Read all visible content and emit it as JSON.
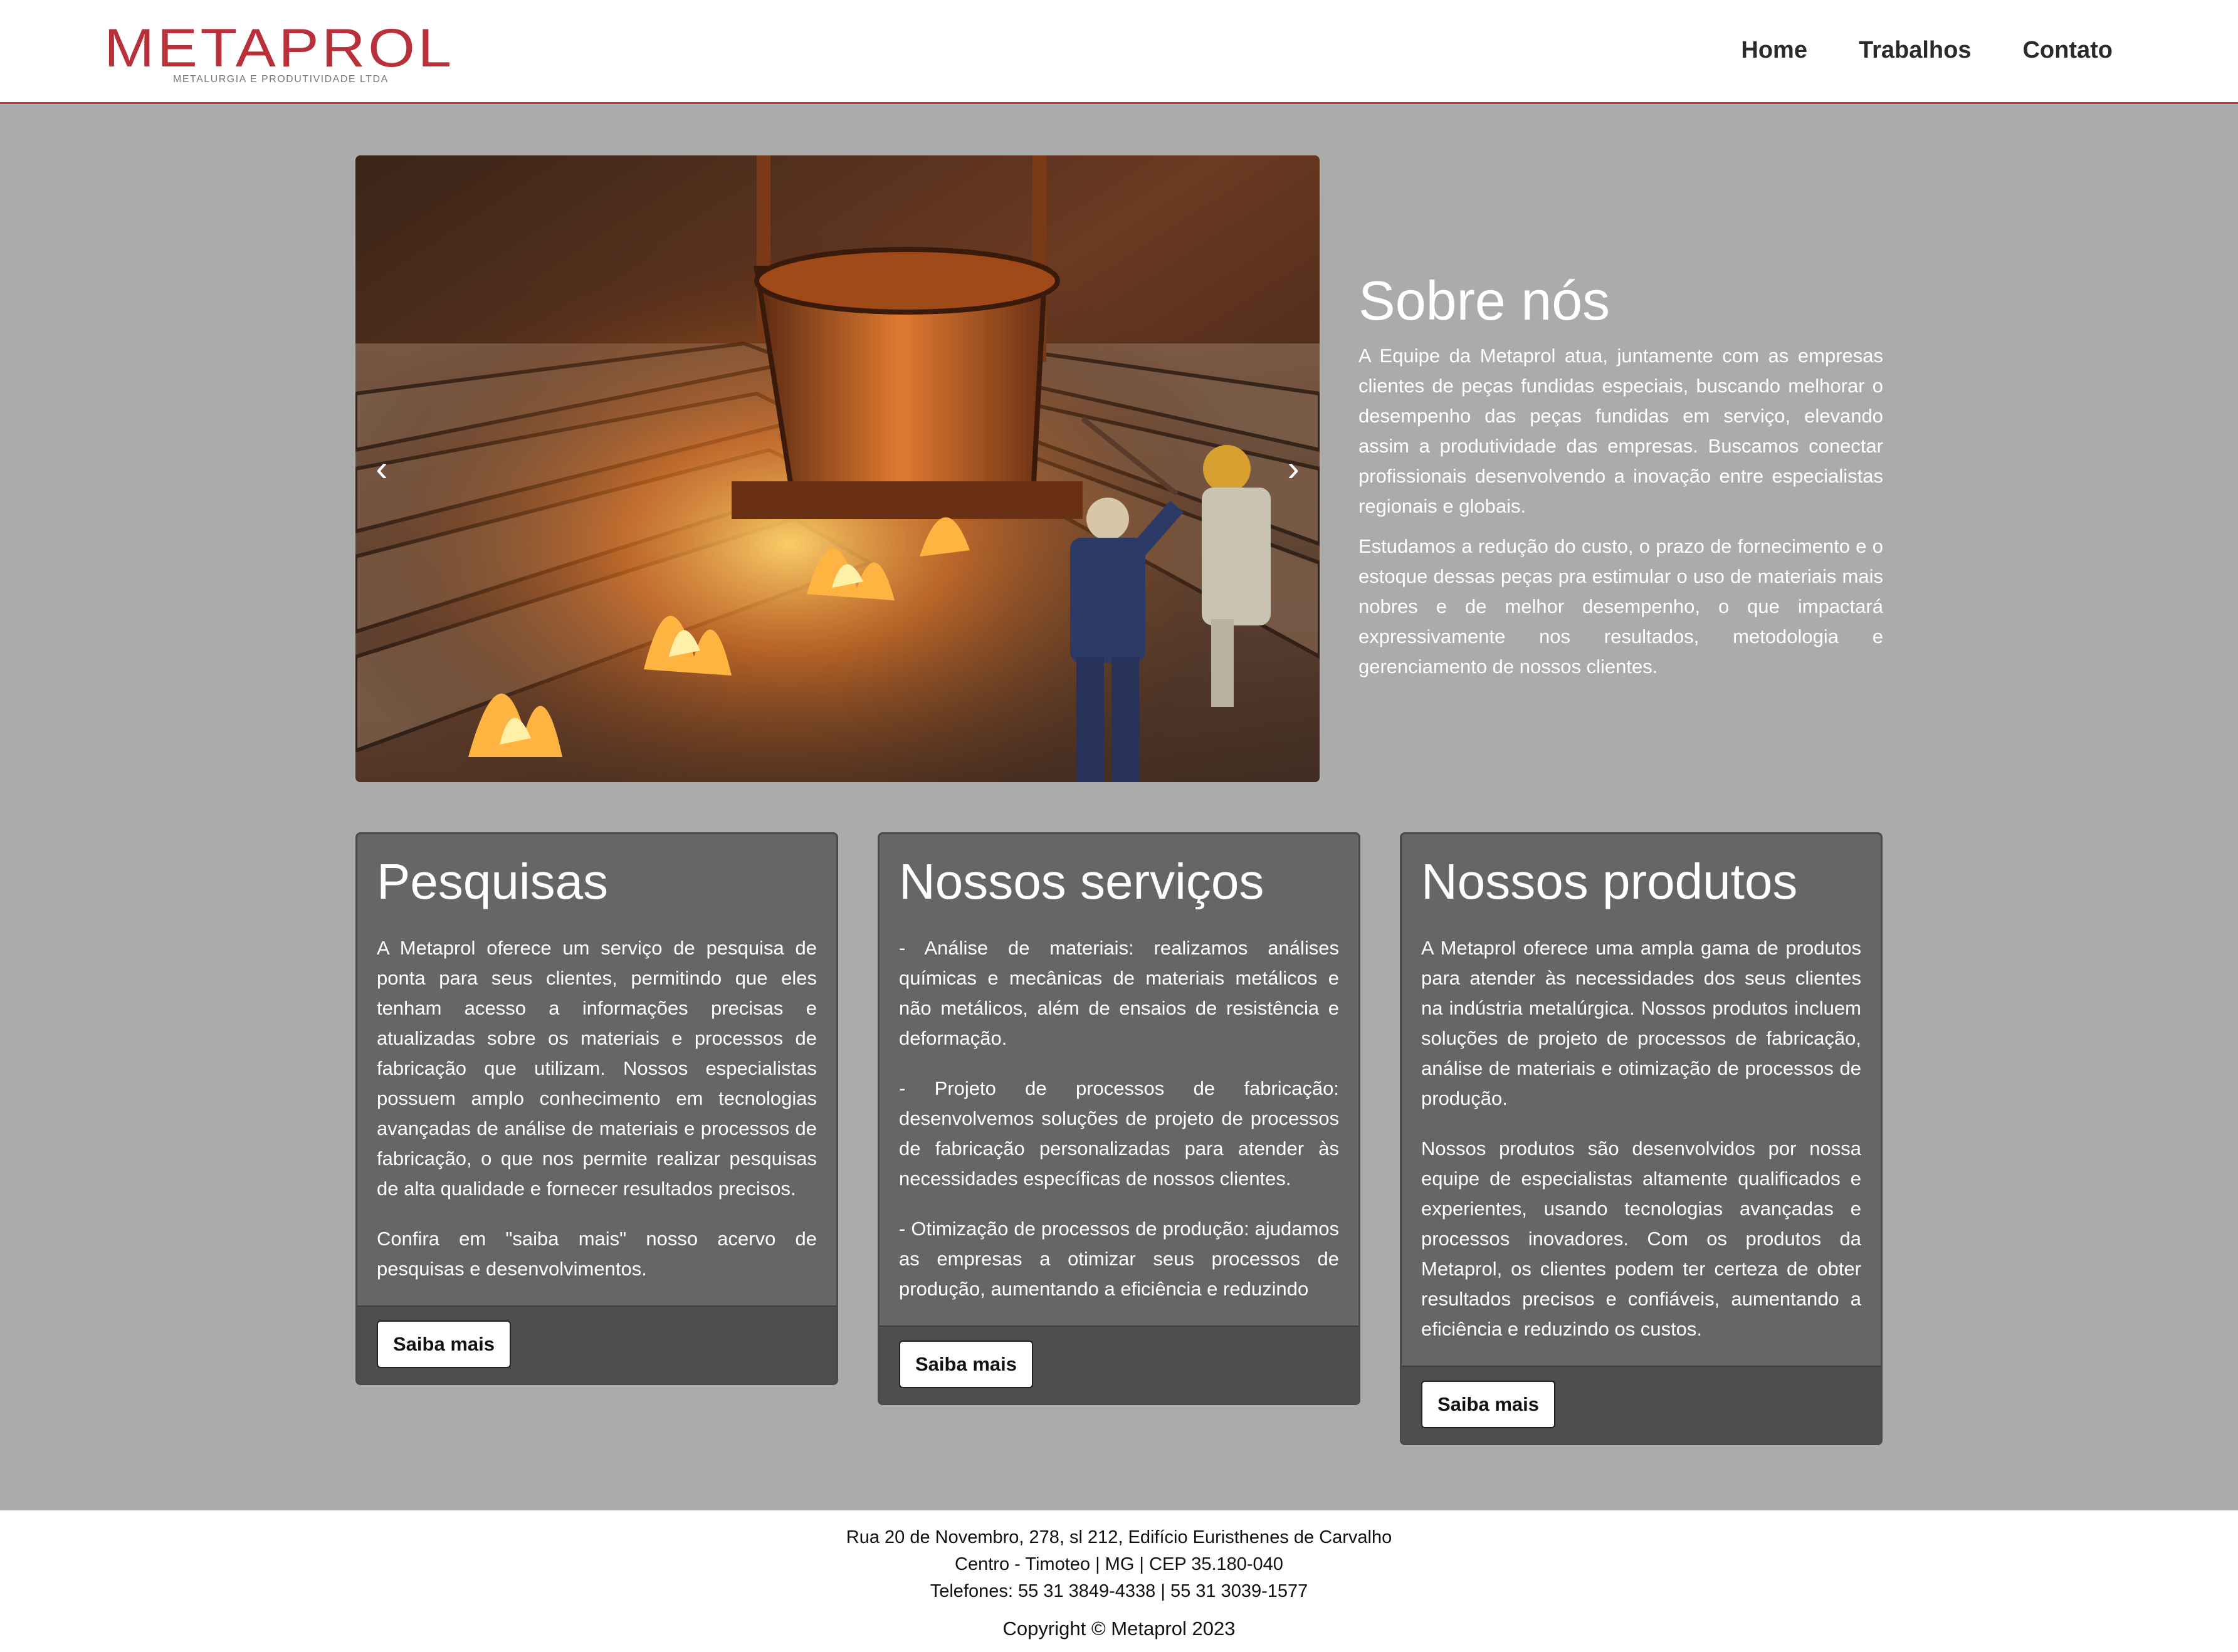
{
  "brand": {
    "name": "METAPROL",
    "tagline": "METALURGIA E PRODUTIVIDADE LTDA",
    "color": "#b8313a"
  },
  "nav": {
    "items": [
      {
        "label": "Home"
      },
      {
        "label": "Trabalhos"
      },
      {
        "label": "Contato"
      }
    ]
  },
  "carousel": {
    "prev_icon": "‹",
    "next_icon": "›",
    "image": "foundry-ladle-pouring-molten-metal"
  },
  "about": {
    "title": "Sobre nós",
    "paragraphs": [
      "A Equipe da Metaprol atua, juntamente com as empresas clientes de peças fundidas especiais, buscando melhorar o desempenho das peças fundidas em serviço, elevando assim a produtividade das empresas. Buscamos conectar profissionais desenvolvendo a inovação entre especialistas regionais e globais.",
      "Estudamos a redução do custo, o prazo de fornecimento e o estoque dessas peças pra estimular o uso de materiais mais nobres e de melhor desempenho, o que impactará expressivamente nos resultados, metodologia e gerenciamento de nossos clientes."
    ]
  },
  "cards": [
    {
      "title": "Pesquisas",
      "paragraphs": [
        "A Metaprol oferece um serviço de pesquisa de ponta para seus clientes, permitindo que eles tenham acesso a informações precisas e atualizadas sobre os materiais e processos de fabricação que utilizam. Nossos especialistas possuem amplo conhecimento em tecnologias avançadas de análise de materiais e processos de fabricação, o que nos permite realizar pesquisas de alta qualidade e fornecer resultados precisos.",
        "Confira em \"saiba mais\" nosso acervo de pesquisas e desenvolvimentos."
      ],
      "button": "Saiba mais"
    },
    {
      "title": "Nossos serviços",
      "paragraphs": [
        "- Análise de materiais: realizamos análises químicas e mecânicas de materiais metálicos e não metálicos, além de ensaios de resistência e deformação.",
        "- Projeto de processos de fabricação: desenvolvemos soluções de projeto de processos de fabricação personalizadas para atender às necessidades específicas de nossos clientes.",
        "- Otimização de processos de produção: ajudamos as empresas a otimizar seus processos de produção, aumentando a eficiência e reduzindo"
      ],
      "button": "Saiba mais"
    },
    {
      "title": "Nossos produtos",
      "paragraphs": [
        "A Metaprol oferece uma ampla gama de produtos para atender às necessidades dos seus clientes na indústria metalúrgica. Nossos produtos incluem soluções de projeto de processos de fabricação, análise de materiais e otimização de processos de produção.",
        "Nossos produtos são desenvolvidos por nossa equipe de especialistas altamente qualificados e experientes, usando tecnologias avançadas e processos inovadores. Com os produtos da Metaprol, os clientes podem ter certeza de obter resultados precisos e confiáveis, aumentando a eficiência e reduzindo os custos."
      ],
      "button": "Saiba mais"
    }
  ],
  "footer": {
    "address": "Rua 20 de Novembro, 278, sl 212, Edifício Euristhenes de Carvalho",
    "city": "Centro - Timoteo | MG | CEP 35.180-040",
    "phones": "Telefones: 55 31 3849-4338 | 55 31 3039-1577",
    "copyright": "Copyright © Metaprol 2023"
  },
  "colors": {
    "page_bg": "#ababab",
    "card_bg": "#666666",
    "card_footer_bg": "#4e4e4e",
    "header_border": "#c9383b"
  }
}
